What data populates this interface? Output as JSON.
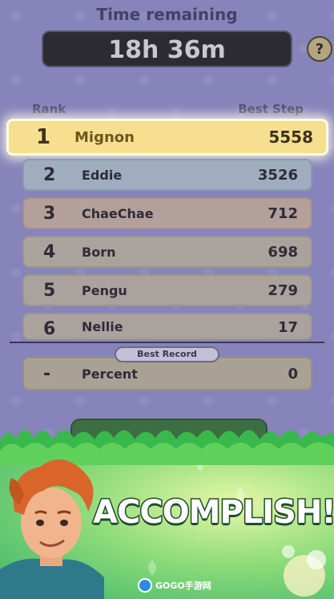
{
  "header": {
    "title": "Time remaining",
    "timer": "18h 36m",
    "help_label": "?"
  },
  "columns": {
    "rank": "Rank",
    "best": "Best Step"
  },
  "leaderboard": [
    {
      "rank": "1",
      "name": "Mignon",
      "score": "5558"
    },
    {
      "rank": "2",
      "name": "Eddie",
      "score": "3526"
    },
    {
      "rank": "3",
      "name": "ChaeChae",
      "score": "712"
    },
    {
      "rank": "4",
      "name": "Born",
      "score": "698"
    },
    {
      "rank": "5",
      "name": "Pengu",
      "score": "279"
    },
    {
      "rank": "6",
      "name": "Nellie",
      "score": "17"
    }
  ],
  "best_record": {
    "badge": "Best Record",
    "rank": "-",
    "name": "Percent",
    "score": "0"
  },
  "banner": {
    "headline": "ACCOMPLISH!",
    "watermark": "GOGO手游网"
  },
  "colors": {
    "highlight": "#f6e08f",
    "panel": "#8784bb",
    "banner_green": "#3ab46a"
  }
}
